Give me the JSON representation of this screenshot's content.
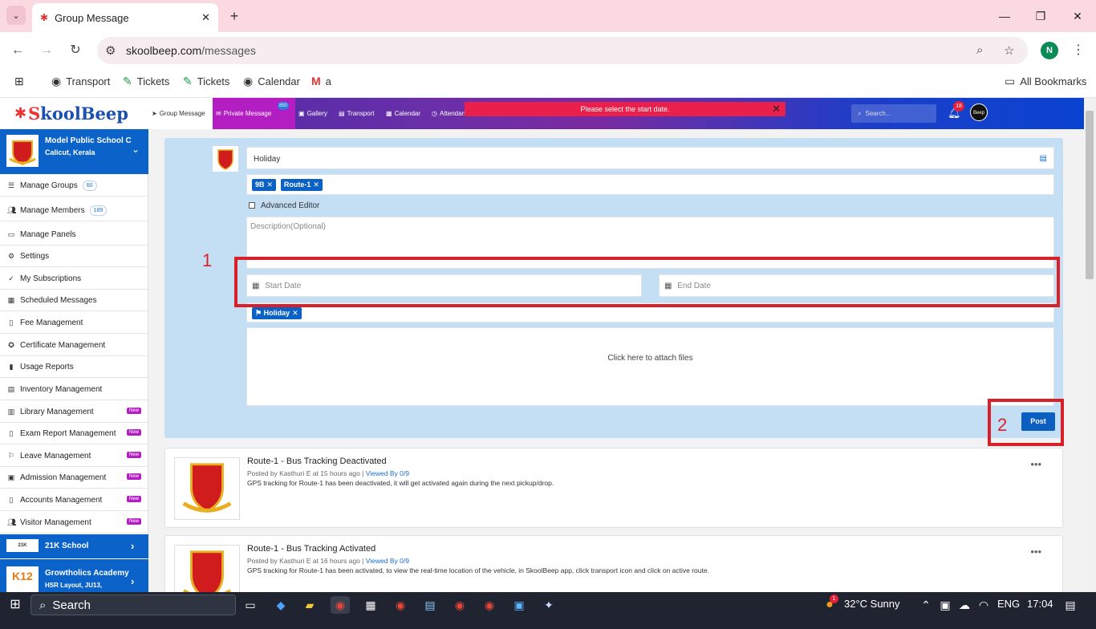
{
  "browser": {
    "tab_title": "Group Message",
    "url_host": "skoolbeep.com",
    "url_path": "/messages",
    "bookmarks": [
      "Transport",
      "Tickets",
      "Tickets",
      "Calendar",
      "a"
    ],
    "all_bookmarks": "All Bookmarks",
    "profile_initial": "N"
  },
  "app": {
    "logo_k": "S",
    "logo_rest": "koolBeep",
    "nav": [
      {
        "label": "Group Message"
      },
      {
        "label": "Private Message"
      },
      {
        "label": "Gallery"
      },
      {
        "label": "Transport"
      },
      {
        "label": "Calendar"
      },
      {
        "label": "Attendance"
      }
    ],
    "pm_badge": "850",
    "alert": "Please select the start date.",
    "search_placeholder": "Search...",
    "notif_count": "18",
    "user_avatar": "Beep"
  },
  "sidebar": {
    "school_name": "Model Public School C",
    "school_loc": "Calicut, Kerala",
    "items": [
      {
        "label": "Manage Groups",
        "count": "60",
        "icon": "list-icon"
      },
      {
        "label": "Manage Members",
        "count": "189",
        "icon": "users-icon"
      },
      {
        "label": "Manage Panels",
        "icon": "monitor-icon"
      },
      {
        "label": "Settings",
        "icon": "gear-icon"
      },
      {
        "label": "My Subscriptions",
        "icon": "check-icon"
      },
      {
        "label": "Scheduled Messages",
        "icon": "calendar-icon"
      },
      {
        "label": "Fee Management",
        "icon": "document-icon"
      },
      {
        "label": "Certificate Management",
        "icon": "certificate-icon"
      },
      {
        "label": "Usage Reports",
        "icon": "bar-chart-icon"
      },
      {
        "label": "Inventory Management",
        "icon": "box-icon"
      },
      {
        "label": "Library Management",
        "new": "New",
        "icon": "book-icon"
      },
      {
        "label": "Exam Report Management",
        "new": "New",
        "icon": "report-icon"
      },
      {
        "label": "Leave Management",
        "new": "New",
        "icon": "leave-icon"
      },
      {
        "label": "Admission Management",
        "new": "New",
        "icon": "admission-icon"
      },
      {
        "label": "Accounts Management",
        "new": "New",
        "icon": "accounts-icon"
      },
      {
        "label": "Visitor Management",
        "new": "New",
        "icon": "visitor-icon"
      }
    ],
    "other_schools": [
      {
        "name": "21K School"
      },
      {
        "name": "Growtholics Academy",
        "loc": "HSR Layout, JU13,"
      }
    ]
  },
  "composer": {
    "title_value": "Holiday",
    "recipients": [
      "9B",
      "Route-1"
    ],
    "advanced_editor": "Advanced Editor",
    "description_placeholder": "Description(Optional)",
    "start_date_placeholder": "Start Date",
    "end_date_placeholder": "End Date",
    "tag": "Holiday",
    "attach": "Click here to attach files",
    "post": "Post",
    "annotation_1": "1",
    "annotation_2": "2"
  },
  "feed": [
    {
      "title": "Route-1 - Bus Tracking Deactivated",
      "meta": "Posted by Kasthuri E at 15 hours ago  |",
      "viewed": "Viewed By 0/9",
      "body": "GPS tracking for Route-1 has been deactivated, it will get activated again during the next pickup/drop."
    },
    {
      "title": "Route-1 - Bus Tracking Activated",
      "meta": "Posted by Kasthuri E at 16 hours ago  |",
      "viewed": "Viewed By 0/9",
      "body": "GPS tracking for Route-1 has been activated, to view the real-time location of the vehicle, in SkoolBeep app, click transport icon and click on active route."
    }
  ],
  "taskbar": {
    "search": "Search",
    "weather": "32°C  Sunny",
    "weather_badge": "1",
    "lang": "ENG",
    "time": "17:04"
  }
}
